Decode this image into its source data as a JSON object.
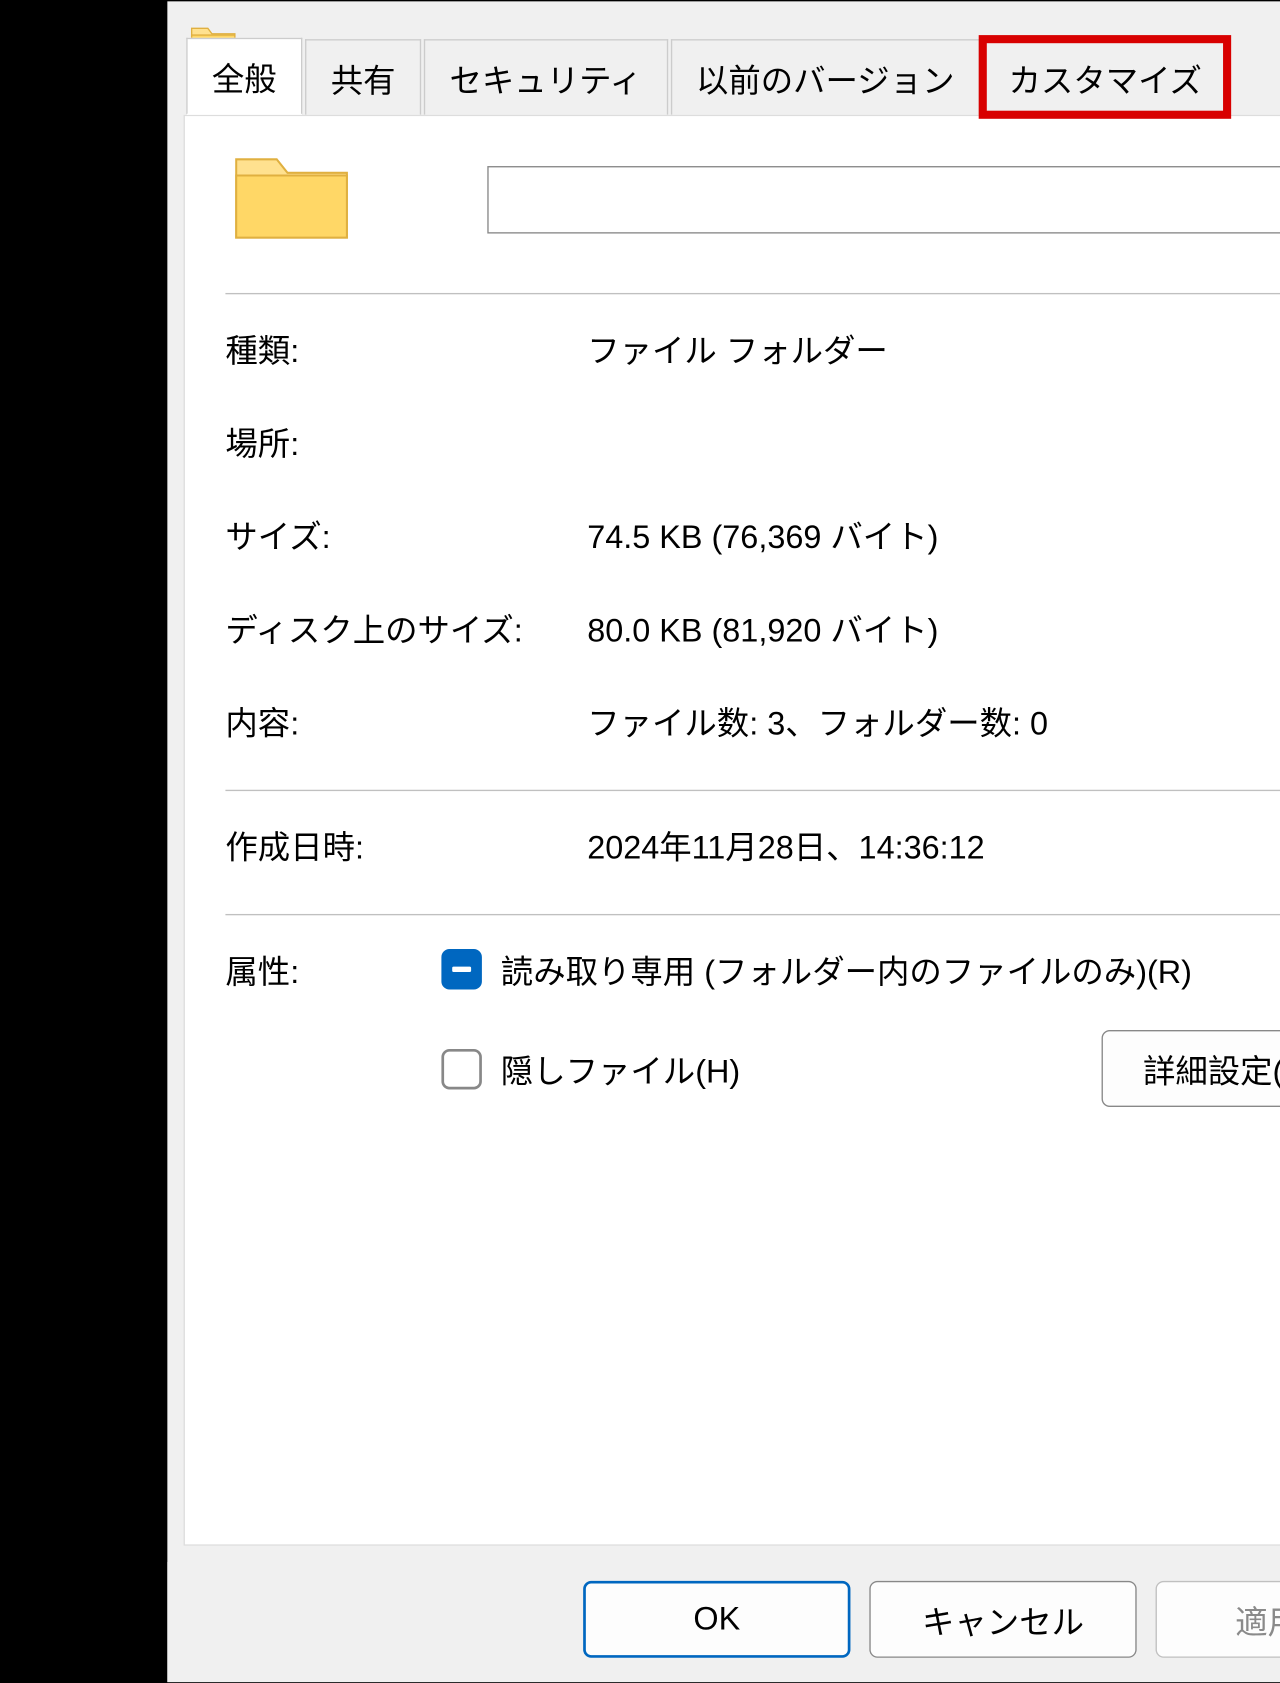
{
  "dialog": {
    "folder_name": ""
  },
  "tabs": [
    {
      "label": "全般"
    },
    {
      "label": "共有"
    },
    {
      "label": "セキュリティ"
    },
    {
      "label": "以前のバージョン"
    },
    {
      "label": "カスタマイズ"
    }
  ],
  "properties": {
    "type_label": "種類:",
    "type_value": "ファイル フォルダー",
    "location_label": "場所:",
    "location_value": "",
    "size_label": "サイズ:",
    "size_value": "74.5 KB (76,369 バイト)",
    "size_on_disk_label": "ディスク上のサイズ:",
    "size_on_disk_value": "80.0 KB (81,920 バイト)",
    "contents_label": "内容:",
    "contents_value": "ファイル数: 3、フォルダー数: 0",
    "created_label": "作成日時:",
    "created_value": "2024年11月28日、14:36:12"
  },
  "attributes": {
    "label": "属性:",
    "readonly_label": "読み取り専用 (フォルダー内のファイルのみ)(R)",
    "hidden_label": "隠しファイル(H)",
    "advanced_button": "詳細設定(D)..."
  },
  "footer": {
    "ok": "OK",
    "cancel": "キャンセル",
    "apply": "適用(A)"
  }
}
